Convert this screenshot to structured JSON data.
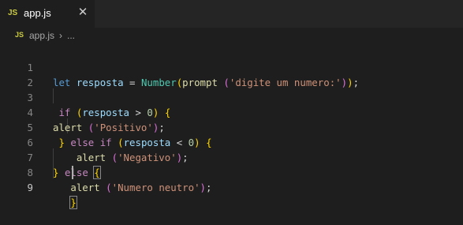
{
  "tab": {
    "icon_label": "JS",
    "title": "app.js",
    "close_glyph": "✕"
  },
  "breadcrumb": {
    "icon_label": "JS",
    "file": "app.js",
    "separator": "›",
    "ellipsis": "..."
  },
  "editor": {
    "line_numbers": [
      "1",
      "2",
      "3",
      "4",
      "5",
      "6",
      "7",
      "8",
      "9"
    ],
    "active_line": "9",
    "lines": [
      "let resposta = Number(prompt ('digite um numero:'));",
      "",
      " if (resposta > 0) {",
      "alert ('Positivo');",
      " } else if (resposta < 0) {",
      "    alert ('Negativo');",
      "} else {",
      "   alert ('Numero neutro');",
      "   }"
    ]
  },
  "colors": {
    "background": "#1e1e1e",
    "keyword": "#569cd6",
    "control": "#c586c0",
    "variable": "#9cdcfe",
    "function": "#dcdcaa",
    "class": "#4ec9b0",
    "string": "#ce9178",
    "number": "#b5cea8",
    "bracket_gold": "#ffd700",
    "bracket_orchid": "#da70d6",
    "bracket_blue": "#179fff"
  }
}
